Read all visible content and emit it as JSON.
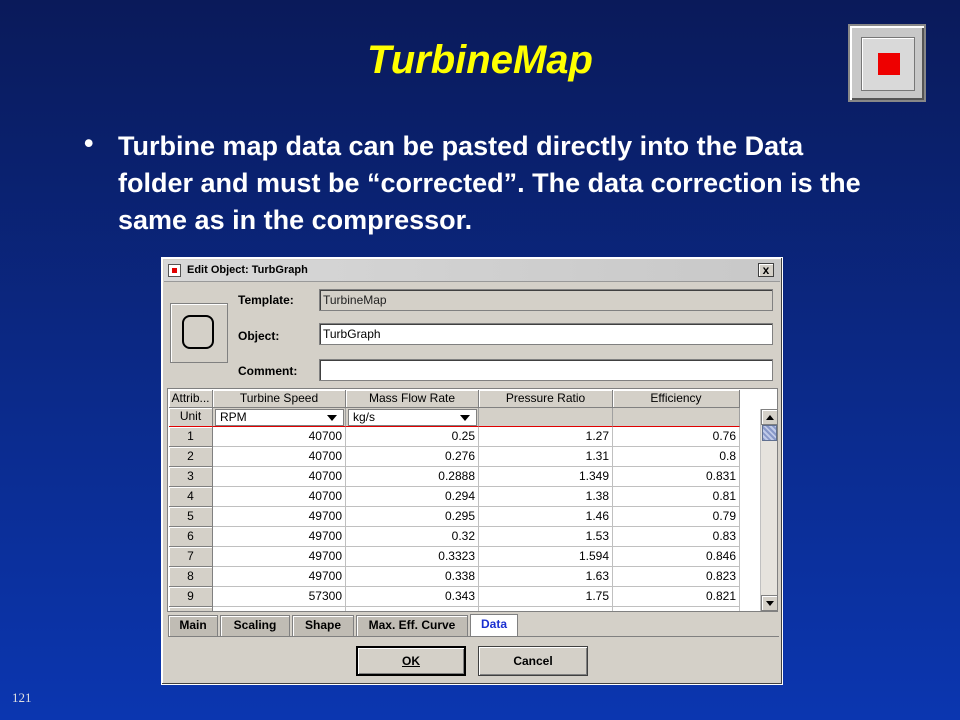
{
  "slide": {
    "title": "TurbineMap",
    "bullet_char": "•",
    "bullet_text": "Turbine map data can be pasted directly into the Data folder and must be “corrected”. The data correction is the same as in the compressor.",
    "page_number": "121"
  },
  "dialog": {
    "title": "Edit Object: TurbGraph",
    "close_glyph": "x",
    "fields": {
      "template_label": "Template:",
      "template_value": "TurbineMap",
      "object_label": "Object:",
      "object_value": "TurbGraph",
      "comment_label": "Comment:",
      "comment_value": ""
    },
    "table": {
      "headers": [
        "Attrib...",
        "Turbine Speed",
        "Mass Flow Rate",
        "Pressure Ratio",
        "Efficiency"
      ],
      "unit_label": "Unit",
      "units": [
        "RPM",
        "kg/s"
      ],
      "rows": [
        {
          "n": "1",
          "speed": "40700",
          "flow": "0.25",
          "pr": "1.27",
          "eff": "0.76"
        },
        {
          "n": "2",
          "speed": "40700",
          "flow": "0.276",
          "pr": "1.31",
          "eff": "0.8"
        },
        {
          "n": "3",
          "speed": "40700",
          "flow": "0.2888",
          "pr": "1.349",
          "eff": "0.831"
        },
        {
          "n": "4",
          "speed": "40700",
          "flow": "0.294",
          "pr": "1.38",
          "eff": "0.81"
        },
        {
          "n": "5",
          "speed": "49700",
          "flow": "0.295",
          "pr": "1.46",
          "eff": "0.79"
        },
        {
          "n": "6",
          "speed": "49700",
          "flow": "0.32",
          "pr": "1.53",
          "eff": "0.83"
        },
        {
          "n": "7",
          "speed": "49700",
          "flow": "0.3323",
          "pr": "1.594",
          "eff": "0.846"
        },
        {
          "n": "8",
          "speed": "49700",
          "flow": "0.338",
          "pr": "1.63",
          "eff": "0.823"
        },
        {
          "n": "9",
          "speed": "57300",
          "flow": "0.343",
          "pr": "1.75",
          "eff": "0.821"
        }
      ]
    },
    "tabs": [
      "Main",
      "Scaling",
      "Shape",
      "Max. Eff. Curve",
      "Data"
    ],
    "active_tab": "Data",
    "buttons": {
      "ok_label": "OK",
      "cancel_label": "Cancel"
    }
  },
  "colors": {
    "title": "#ffff00",
    "background_top": "#0a1a5a",
    "background_bottom": "#0b36b0",
    "active_tab_text": "#1a2fd0",
    "stop_red": "#ee0000"
  },
  "icons": [
    "stop-icon",
    "app-icon",
    "close-icon",
    "object-shape-icon",
    "scroll-up-icon",
    "scroll-down-icon",
    "dropdown-arrow-icon"
  ]
}
